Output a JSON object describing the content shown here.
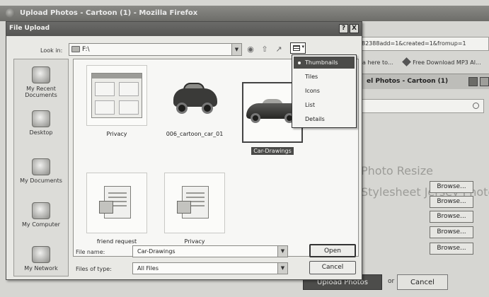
{
  "background_window": {
    "title": "Upload Photos - Cartoon (1) - Mozilla Firefox",
    "url_fragment": "82388add=1&created=1&fromup=1",
    "bookmarks": [
      "a here to...",
      "Free Download MP3 Al..."
    ],
    "tab_title": "el Photos - Cartoon (1)",
    "page_text": [
      "Photo Resize",
      "Stylesheet Jersey Photos"
    ],
    "browse_label": "Browse...",
    "upload_button": "Upload Photos",
    "or_text": "or",
    "cancel_button": "Cancel"
  },
  "dialog": {
    "title": "File Upload",
    "title_buttons": [
      "?",
      "X"
    ],
    "look_in_label": "Look in:",
    "look_in_value": "F:\\",
    "toolbar_icons": [
      "back-icon",
      "up-folder-icon",
      "new-folder-icon",
      "views-icon"
    ],
    "places": [
      {
        "label_line1": "My Recent",
        "label_line2": "Documents",
        "icon": "recent-documents-icon"
      },
      {
        "label_line1": "Desktop",
        "label_line2": "",
        "icon": "desktop-icon"
      },
      {
        "label_line1": "My Documents",
        "label_line2": "",
        "icon": "my-documents-icon"
      },
      {
        "label_line1": "My Computer",
        "label_line2": "",
        "icon": "my-computer-icon"
      },
      {
        "label_line1": "My Network",
        "label_line2": "",
        "icon": "my-network-icon"
      }
    ],
    "files": [
      {
        "name": "Privacy",
        "selected": false
      },
      {
        "name": "006_cartoon_car_01",
        "selected": false
      },
      {
        "name": "Car-Drawings",
        "selected": true
      },
      {
        "name": "friend request",
        "selected": false
      },
      {
        "name": "Privacy",
        "selected": false
      }
    ],
    "views_menu": [
      {
        "label": "Thumbnails",
        "active": true
      },
      {
        "label": "Tiles",
        "active": false
      },
      {
        "label": "Icons",
        "active": false
      },
      {
        "label": "List",
        "active": false
      },
      {
        "label": "Details",
        "active": false
      }
    ],
    "file_name_label": "File name:",
    "file_name_value": "Car-Drawings",
    "file_type_label": "Files of type:",
    "file_type_value": "All Files",
    "open_button": "Open",
    "cancel_button": "Cancel"
  }
}
